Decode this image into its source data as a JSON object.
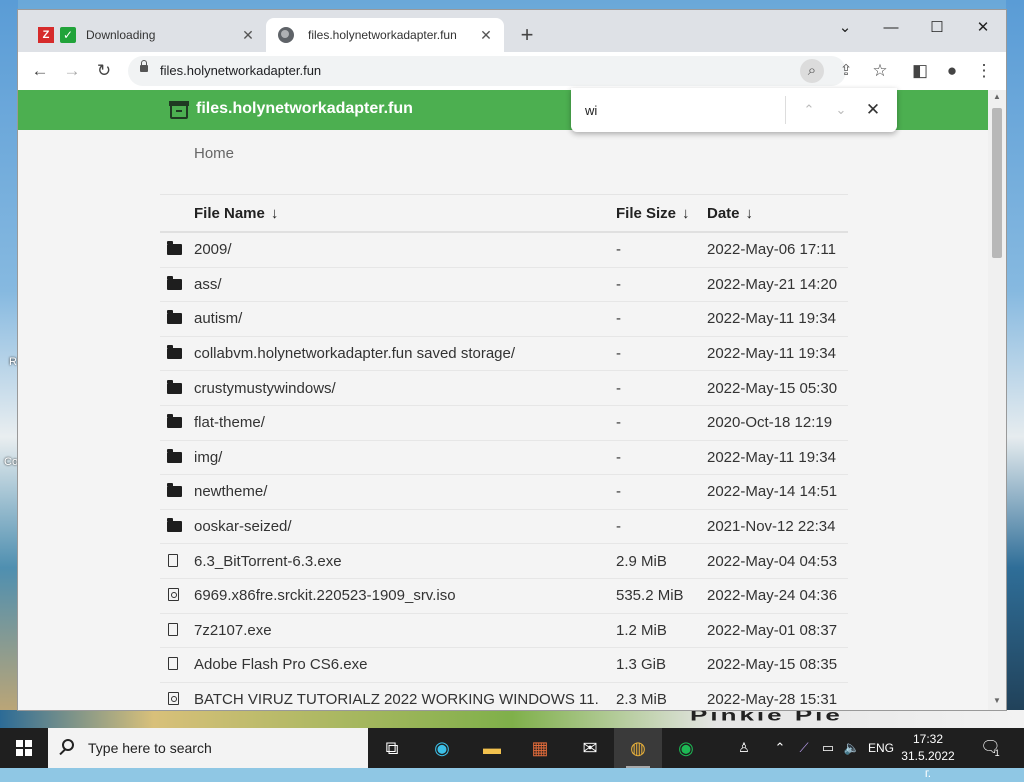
{
  "desktop": {
    "edge_text_1": "R",
    "edge_text_2": "Co",
    "bottom_text": "Pinkie Pie"
  },
  "browser": {
    "tabs": [
      {
        "title": "Downloading"
      },
      {
        "title": "files.holynetworkadapter.fun"
      }
    ],
    "new_tab": "+",
    "url": "files.holynetworkadapter.fun"
  },
  "find_bar": {
    "query": "wi"
  },
  "page": {
    "site_title": "files.holynetworkadapter.fun",
    "breadcrumb": "Home",
    "columns": {
      "name": "File Name",
      "size": "File Size",
      "date": "Date",
      "sort_indicator": "↓"
    },
    "rows": [
      {
        "type": "folder",
        "name": "2009/",
        "size": "-",
        "date": "2022-May-06 17:11"
      },
      {
        "type": "folder",
        "name": "ass/",
        "size": "-",
        "date": "2022-May-21 14:20"
      },
      {
        "type": "folder",
        "name": "autism/",
        "size": "-",
        "date": "2022-May-11 19:34"
      },
      {
        "type": "folder",
        "name": "collabvm.holynetworkadapter.fun saved storage/",
        "size": "-",
        "date": "2022-May-11 19:34"
      },
      {
        "type": "folder",
        "name": "crustymustywindows/",
        "size": "-",
        "date": "2022-May-15 05:30"
      },
      {
        "type": "folder",
        "name": "flat-theme/",
        "size": "-",
        "date": "2020-Oct-18 12:19"
      },
      {
        "type": "folder",
        "name": "img/",
        "size": "-",
        "date": "2022-May-11 19:34"
      },
      {
        "type": "folder",
        "name": "newtheme/",
        "size": "-",
        "date": "2022-May-14 14:51"
      },
      {
        "type": "folder",
        "name": "ooskar-seized/",
        "size": "-",
        "date": "2021-Nov-12 22:34"
      },
      {
        "type": "file",
        "name": "6.3_BitTorrent-6.3.exe",
        "size": "2.9 MiB",
        "date": "2022-May-04 04:53"
      },
      {
        "type": "disc",
        "name": "6969.x86fre.srckit.220523-1909_srv.iso",
        "size": "535.2 MiB",
        "date": "2022-May-24 04:36"
      },
      {
        "type": "file",
        "name": "7z2107.exe",
        "size": "1.2 MiB",
        "date": "2022-May-01 08:37"
      },
      {
        "type": "file",
        "name": "Adobe Flash Pro CS6.exe",
        "size": "1.3 GiB",
        "date": "2022-May-15 08:35"
      },
      {
        "type": "disc",
        "name": "BATCH VIRUZ TUTORIALZ 2022 WORKING WINDOWS 11.",
        "size": "2.3 MiB",
        "date": "2022-May-28 15:31"
      }
    ]
  },
  "taskbar": {
    "search_placeholder": "Type here to search",
    "language": "ENG",
    "time": "17:32",
    "date": "31.5.2022 г.",
    "notification_count": "1"
  },
  "colors": {
    "site_banner": "#4caf50",
    "taskbar": "#1f1f1f"
  }
}
